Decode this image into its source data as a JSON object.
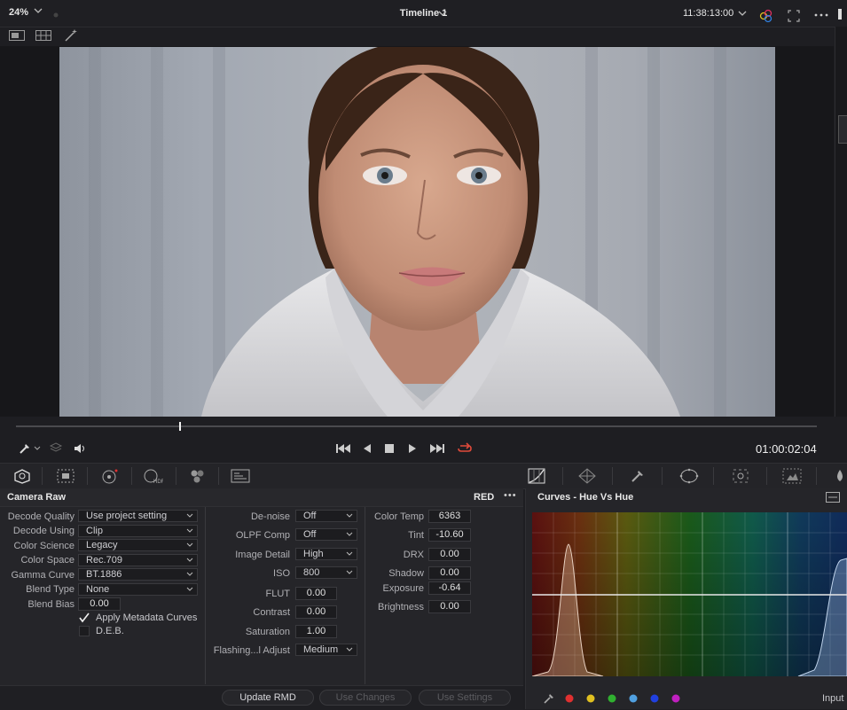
{
  "topbar": {
    "zoom": "24%",
    "timeline_title": "Timeline 1",
    "timecode": "11:38:13:00"
  },
  "transport": {
    "timecode": "01:00:02:04",
    "playhead_fraction": 0.205
  },
  "camera_raw": {
    "title": "Camera Raw",
    "source": "RED",
    "more_label": "•••",
    "left_fields": [
      {
        "label": "Decode Quality",
        "value": "Use project setting"
      },
      {
        "label": "Decode Using",
        "value": "Clip"
      },
      {
        "label": "Color Science",
        "value": "Legacy"
      },
      {
        "label": "Color Space",
        "value": "Rec.709"
      },
      {
        "label": "Gamma Curve",
        "value": "BT.1886"
      },
      {
        "label": "Blend Type",
        "value": "None"
      }
    ],
    "blend_bias": {
      "label": "Blend Bias",
      "value": "0.00"
    },
    "checkboxes": [
      {
        "label": "Apply Metadata Curves",
        "checked": true
      },
      {
        "label": "D.E.B.",
        "checked": false
      }
    ],
    "mid_fields": [
      {
        "label": "De-noise",
        "value": "Off",
        "type": "dropdown"
      },
      {
        "label": "OLPF Comp",
        "value": "Off",
        "type": "dropdown"
      },
      {
        "label": "Image Detail",
        "value": "High",
        "type": "dropdown"
      },
      {
        "label": "ISO",
        "value": "800",
        "type": "dropdown"
      },
      {
        "label": "FLUT",
        "value": "0.00",
        "type": "number"
      },
      {
        "label": "Contrast",
        "value": "0.00",
        "type": "number"
      },
      {
        "label": "Saturation",
        "value": "1.00",
        "type": "number"
      },
      {
        "label": "Flashing...l Adjust",
        "value": "Medium",
        "type": "dropdown"
      }
    ],
    "right_fields": [
      {
        "label": "Color Temp",
        "value": "6363"
      },
      {
        "label": "Tint",
        "value": "-10.60"
      },
      {
        "label": "DRX",
        "value": "0.00"
      },
      {
        "label": "Shadow",
        "value": "0.00"
      },
      {
        "label": "Exposure",
        "value": "-0.64"
      },
      {
        "label": "Brightness",
        "value": "0.00"
      }
    ],
    "buttons": {
      "update_rmd": "Update RMD",
      "use_changes": "Use Changes",
      "use_settings": "Use Settings"
    }
  },
  "curves": {
    "title": "Curves - Hue Vs Hue",
    "input_label": "Input",
    "swatch_colors": [
      "#e03030",
      "#e0c020",
      "#30b030",
      "#50a0e0",
      "#2040e0",
      "#c020c0"
    ]
  },
  "colors": {
    "accent_loop": "#e04a3a",
    "panel_bg": "#252529"
  }
}
